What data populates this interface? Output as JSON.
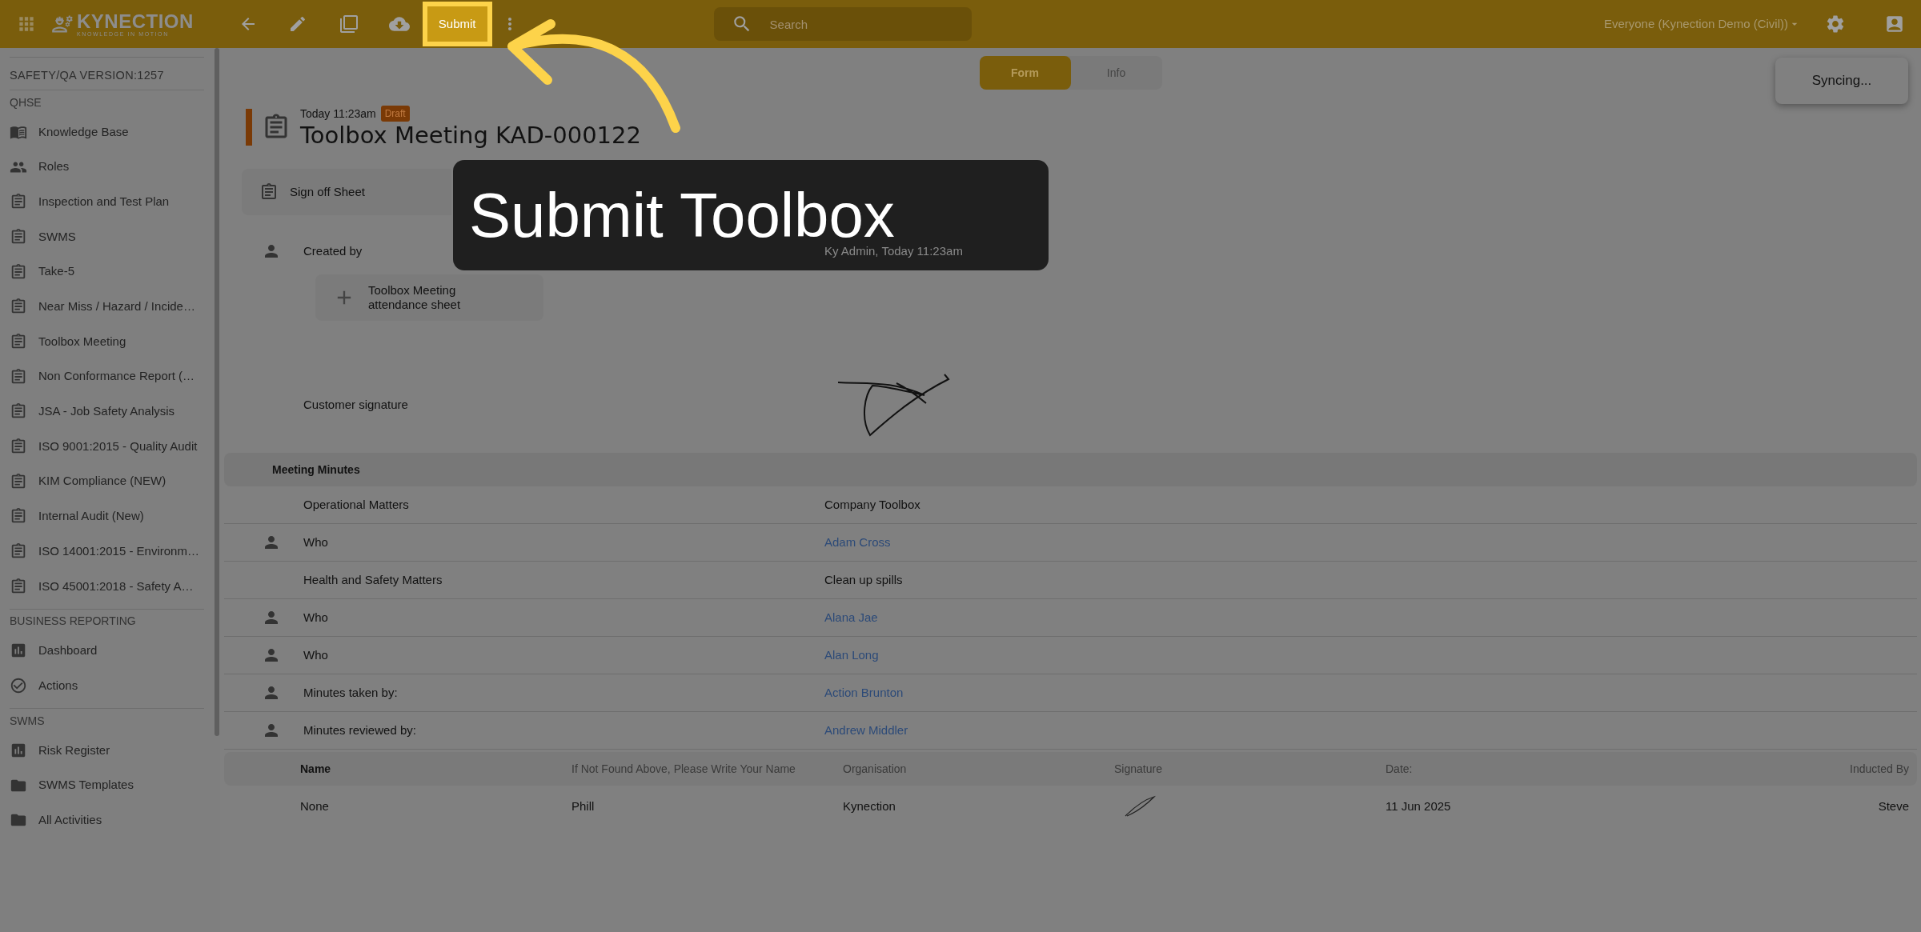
{
  "top_bar": {
    "logo": {
      "name": "KYNECTION",
      "tagline": "KNOWLEDGE IN MOTION"
    },
    "submit_button": {
      "label": "Submit",
      "highlighted": true
    },
    "search": {
      "placeholder": "Search"
    },
    "workspace": "Everyone (Kynection Demo (Civil))"
  },
  "sidebar": {
    "version": "SAFETY/QA VERSION:1257",
    "sections": [
      {
        "title": "QHSE",
        "items": [
          {
            "label": "Knowledge Base",
            "kind": "book"
          },
          {
            "label": "Roles",
            "kind": "people"
          },
          {
            "label": "Inspection and Test Plan",
            "kind": "clipboard"
          },
          {
            "label": "SWMS",
            "kind": "clipboard"
          },
          {
            "label": "Take-5",
            "kind": "clipboard"
          },
          {
            "label": "Near Miss / Hazard / Incide…",
            "kind": "clipboard"
          },
          {
            "label": "Toolbox Meeting",
            "kind": "clipboard"
          },
          {
            "label": "Non Conformance Report (…",
            "kind": "clipboard"
          },
          {
            "label": "JSA - Job Safety Analysis",
            "kind": "clipboard"
          },
          {
            "label": "ISO 9001:2015 - Quality Audit",
            "kind": "clipboard"
          },
          {
            "label": "KIM Compliance (NEW)",
            "kind": "clipboard"
          },
          {
            "label": "Internal Audit (New)",
            "kind": "clipboard"
          },
          {
            "label": "ISO 14001:2015 - Environm…",
            "kind": "clipboard"
          },
          {
            "label": "ISO 45001:2018 - Safety A…",
            "kind": "clipboard"
          }
        ]
      },
      {
        "title": "BUSINESS REPORTING",
        "items": [
          {
            "label": "Dashboard",
            "kind": "chart"
          },
          {
            "label": "Actions",
            "kind": "check"
          }
        ]
      },
      {
        "title": "SWMS",
        "items": [
          {
            "label": "Risk Register",
            "kind": "chart"
          },
          {
            "label": "SWMS Templates",
            "kind": "folder"
          },
          {
            "label": "All Activities",
            "kind": "folder"
          }
        ]
      }
    ]
  },
  "view_tabs": [
    {
      "label": "Form",
      "selected": true
    },
    {
      "label": "Info",
      "selected": false
    }
  ],
  "sync_status": "Syncing...",
  "record": {
    "timestamp": "Today 11:23am",
    "status": "Draft",
    "title": "Toolbox Meeting KAD-000122"
  },
  "sign_off": {
    "label": "Sign off Sheet"
  },
  "created_by": {
    "label": "Created by",
    "value": "Ky Admin, Today 11:23am"
  },
  "add_button": "Toolbox Meeting attendance sheet",
  "customer_signature": {
    "label": "Customer signature"
  },
  "minutes": {
    "title": "Meeting Minutes",
    "rows": [
      {
        "label": "Operational Matters",
        "value": "Company Toolbox",
        "kind": "text"
      },
      {
        "label": "Who",
        "value": "Adam Cross",
        "kind": "person"
      },
      {
        "label": "Health and Safety Matters",
        "value": "Clean up spills",
        "kind": "text"
      },
      {
        "label": "Who",
        "value": "Alana Jae",
        "kind": "person"
      },
      {
        "label": "Who",
        "value": "Alan Long",
        "kind": "person"
      },
      {
        "label": "Minutes taken by:",
        "value": "Action Brunton",
        "kind": "person"
      },
      {
        "label": "Minutes reviewed by:",
        "value": "Andrew Middler",
        "kind": "person"
      }
    ]
  },
  "attendance": {
    "columns": [
      "Name",
      "If Not Found Above, Please Write Your Name",
      "Organisation",
      "Signature",
      "Date:",
      "Inducted By"
    ],
    "rows": [
      {
        "cells": [
          {
            "kind": "text",
            "text": "None"
          },
          {
            "kind": "text",
            "text": "Phill"
          },
          {
            "kind": "text",
            "text": "Kynection"
          },
          {
            "kind": "signature"
          },
          {
            "kind": "text",
            "text": "11 Jun 2025"
          },
          {
            "kind": "text",
            "text": "Steve"
          }
        ]
      }
    ]
  },
  "tutorial": {
    "text": "Submit Toolbox"
  }
}
